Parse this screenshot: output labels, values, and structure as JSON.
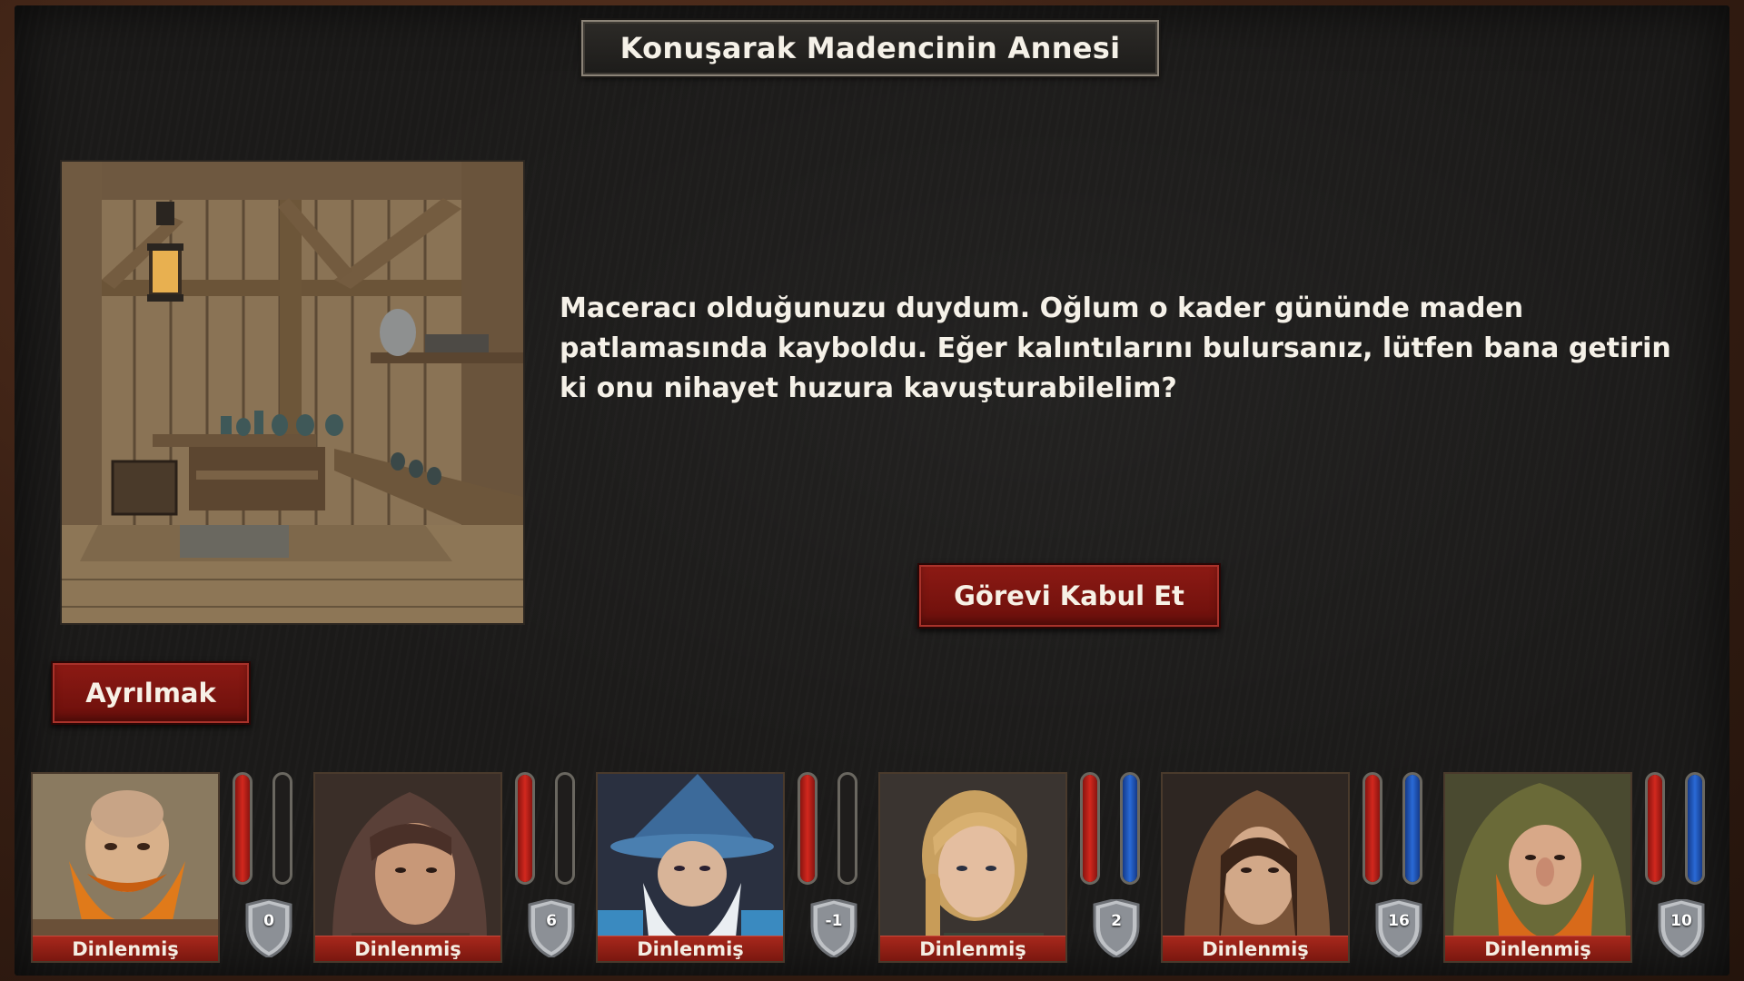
{
  "title": "Konuşarak Madencinin Annesi",
  "dialogue": "Maceracı olduğunuzu duydum. Oğlum o kader gününde maden patlamasında kayboldu. Eğer kalıntılarını bulursanız, lütfen bana getirin ki onu nihayet huzura kavuşturabilelim?",
  "buttons": {
    "accept": "Görevi Kabul Et",
    "leave": "Ayrılmak"
  },
  "party": [
    {
      "status": "Dinlenmiş",
      "armor": "0",
      "health": 1.0,
      "mana": 0.0,
      "portrait": "dwarf-orange-beard"
    },
    {
      "status": "Dinlenmiş",
      "armor": "6",
      "health": 1.0,
      "mana": 0.0,
      "portrait": "hooded-man"
    },
    {
      "status": "Dinlenmiş",
      "armor": "-1",
      "health": 1.0,
      "mana": 0.0,
      "portrait": "wizard-blue-hat"
    },
    {
      "status": "Dinlenmiş",
      "armor": "2",
      "health": 1.0,
      "mana": 1.0,
      "portrait": "blonde-woman-braid"
    },
    {
      "status": "Dinlenmiş",
      "armor": "16",
      "health": 1.0,
      "mana": 1.0,
      "portrait": "hooded-woman"
    },
    {
      "status": "Dinlenmiş",
      "armor": "10",
      "health": 1.0,
      "mana": 1.0,
      "portrait": "dwarf-green-hood"
    }
  ],
  "colors": {
    "button": "#8d1a14",
    "health": "#d2281e",
    "mana": "#2a6ad6",
    "background": "#1b1a19"
  }
}
